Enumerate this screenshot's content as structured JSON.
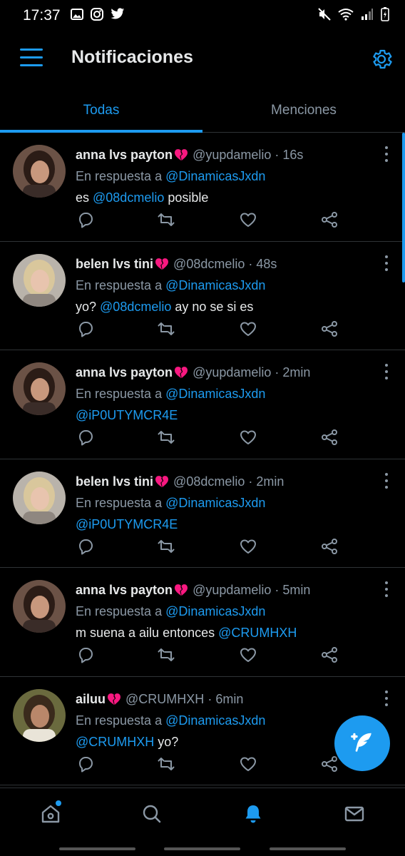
{
  "status_bar": {
    "time": "17:37",
    "left_icons": [
      "gallery-icon",
      "instagram-icon",
      "twitter-icon"
    ],
    "right_icons": [
      "mute-icon",
      "wifi-icon",
      "signal-icon",
      "battery-icon"
    ]
  },
  "header": {
    "title": "Notificaciones"
  },
  "tabs": [
    {
      "label": "Todas",
      "active": true
    },
    {
      "label": "Menciones",
      "active": false
    }
  ],
  "reply_prefix": "En respuesta a",
  "tweets": [
    {
      "name": "anna lvs payton",
      "handle": "@yupdamelio",
      "time": "16s",
      "reply_to": "@DinamicasJxdn",
      "text_parts": [
        {
          "t": "es ",
          "m": false
        },
        {
          "t": "@08dcmelio",
          "m": true
        },
        {
          "t": " posible",
          "m": false
        }
      ]
    },
    {
      "name": "belen lvs tini",
      "handle": "@08dcmelio",
      "time": "48s",
      "reply_to": "@DinamicasJxdn",
      "text_parts": [
        {
          "t": "yo? ",
          "m": false
        },
        {
          "t": "@08dcmelio",
          "m": true
        },
        {
          "t": " ay no se si es",
          "m": false
        }
      ]
    },
    {
      "name": "anna lvs payton",
      "handle": "@yupdamelio",
      "time": "2min",
      "reply_to": "@DinamicasJxdn",
      "text_parts": [
        {
          "t": "@iP0UTYMCR4E",
          "m": true
        }
      ]
    },
    {
      "name": "belen lvs tini",
      "handle": "@08dcmelio",
      "time": "2min",
      "reply_to": "@DinamicasJxdn",
      "text_parts": [
        {
          "t": "@iP0UTYMCR4E",
          "m": true
        }
      ]
    },
    {
      "name": "anna lvs payton",
      "handle": "@yupdamelio",
      "time": "5min",
      "reply_to": "@DinamicasJxdn",
      "text_parts": [
        {
          "t": "m suena a ailu entonces ",
          "m": false
        },
        {
          "t": "@CRUMHXH",
          "m": true
        }
      ]
    },
    {
      "name": "ailuu",
      "handle": "@CRUMHXH",
      "time": "6min",
      "reply_to": "@DinamicasJxdn",
      "text_parts": [
        {
          "t": "@CRUMHXH",
          "m": true
        },
        {
          "t": " yo?",
          "m": false
        }
      ]
    }
  ],
  "bottom_nav": [
    {
      "icon": "home-icon",
      "active": false,
      "dot": true
    },
    {
      "icon": "search-icon",
      "active": false,
      "dot": false
    },
    {
      "icon": "bell-icon",
      "active": true,
      "dot": false
    },
    {
      "icon": "mail-icon",
      "active": false,
      "dot": false
    }
  ],
  "colors": {
    "accent": "#1d9bf0",
    "background": "#000000",
    "muted_text": "#8b98a5",
    "divider": "#2f3336",
    "broken_heart": "#f91880"
  }
}
